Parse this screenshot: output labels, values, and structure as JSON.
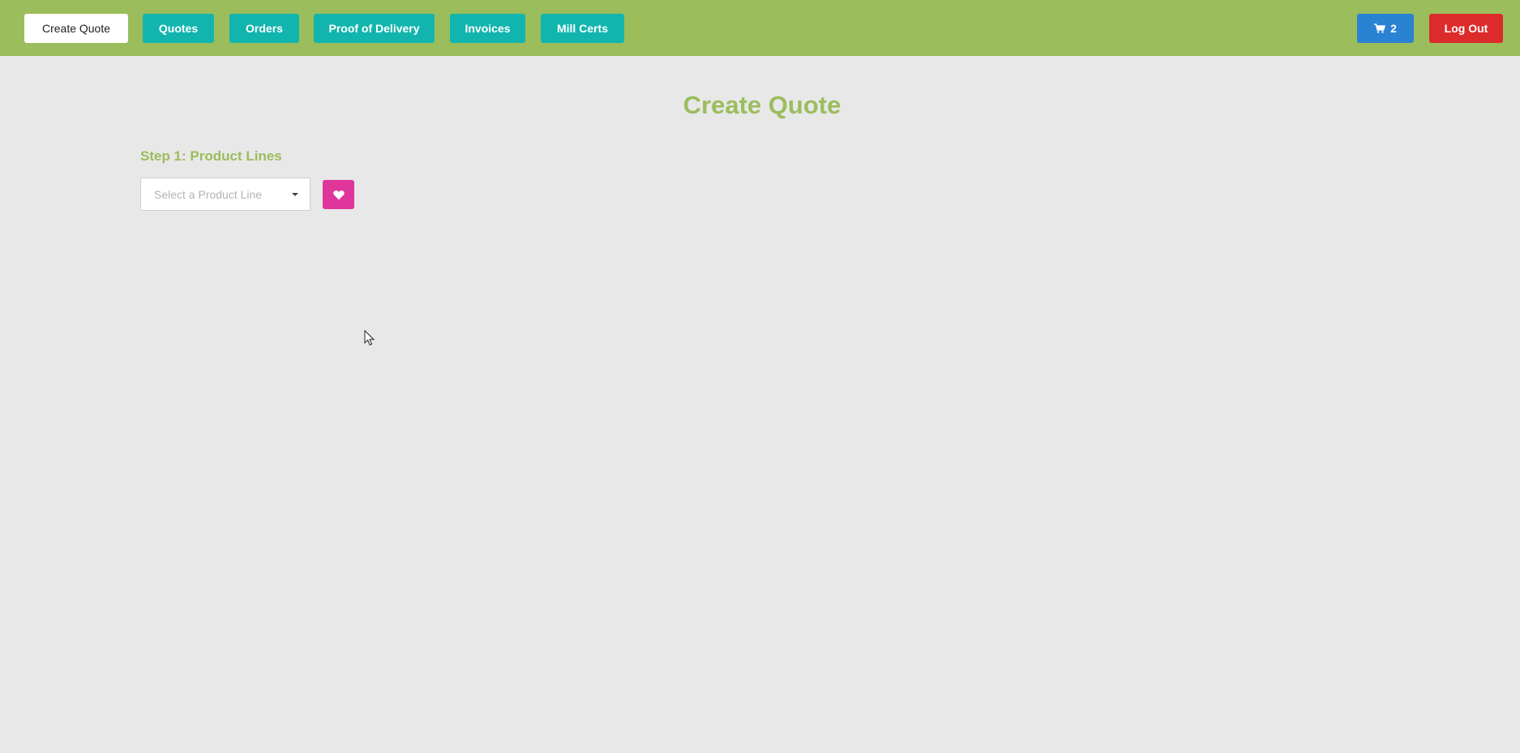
{
  "nav": {
    "create_quote": "Create Quote",
    "quotes": "Quotes",
    "orders": "Orders",
    "proof_of_delivery": "Proof of Delivery",
    "invoices": "Invoices",
    "mill_certs": "Mill Certs",
    "cart_count": "2",
    "logout": "Log Out"
  },
  "page": {
    "title": "Create Quote",
    "step_label": "Step 1: Product Lines",
    "select_placeholder": "Select a Product Line"
  },
  "icons": {
    "cart": "shopping-cart-icon",
    "favorite": "heart-icon",
    "caret": "caret-down-icon"
  },
  "colors": {
    "topbar": "#9bbd5c",
    "nav_teal": "#12b5ad",
    "cart_blue": "#2a83d2",
    "logout_red": "#dc2b2b",
    "favorite_pink": "#e0359a",
    "title_green": "#9bbd5c",
    "background": "#e8e8e8"
  }
}
